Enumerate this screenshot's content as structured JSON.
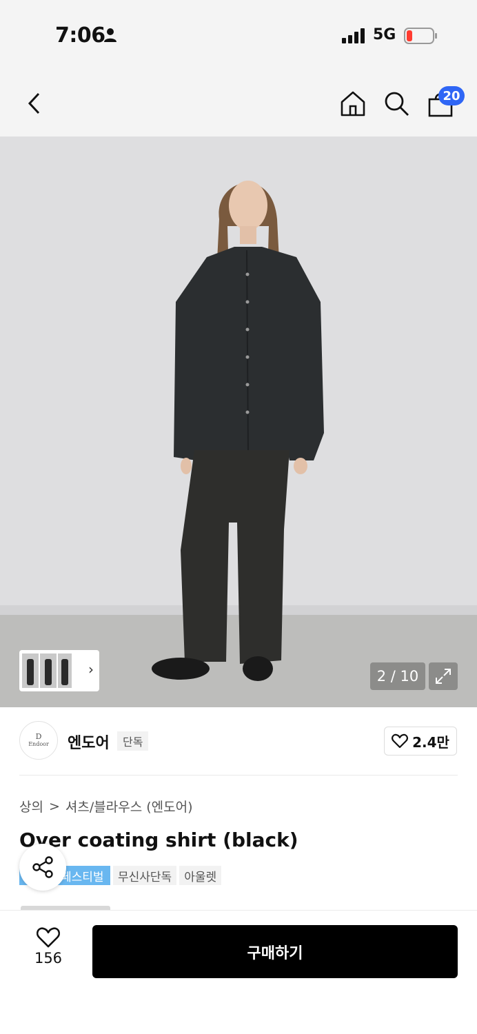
{
  "status_bar": {
    "time": "7:06",
    "network": "5G"
  },
  "header": {
    "cart_count": "20"
  },
  "gallery": {
    "counter": "2 / 10"
  },
  "brand": {
    "logo_mark": "D",
    "logo_word": "Endoor",
    "name": "엔도어",
    "exclusive_tag": "단독",
    "likes": "2.4만"
  },
  "product": {
    "breadcrumb": [
      "상의",
      "셔츠/블라우스 (엔도어)"
    ],
    "breadcrumb_separator": ">",
    "title": "Over coating shirt (black)",
    "tags": [
      "페스티벌",
      "무신사단독",
      "아울렛"
    ]
  },
  "bottom_bar": {
    "wish_count": "156",
    "buy_label": "구매하기"
  },
  "colors": {
    "badge": "#2f66f5",
    "festival_tag": "#69b7f0",
    "buy_button": "#000000",
    "battery_low": "#ff3b30"
  },
  "icons": [
    "person-icon",
    "signal-icon",
    "battery-icon",
    "back-icon",
    "home-icon",
    "search-icon",
    "cart-icon",
    "expand-icon",
    "heart-icon",
    "share-icon",
    "chevron-right-icon"
  ]
}
